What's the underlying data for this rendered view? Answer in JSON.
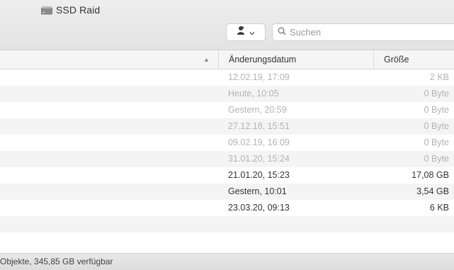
{
  "window": {
    "volume_name": "SSD Raid"
  },
  "toolbar": {
    "search_placeholder": "Suchen"
  },
  "columns": {
    "date": "Änderungsdatum",
    "size": "Größe"
  },
  "rows": [
    {
      "date": "12.02.19, 17:09",
      "size": "2 KB",
      "dim": true
    },
    {
      "date": "Heute, 10:05",
      "size": "0 Byte",
      "dim": true
    },
    {
      "date": "Gestern, 20:59",
      "size": "0 Byte",
      "dim": true
    },
    {
      "date": "27.12.18, 15:51",
      "size": "0 Byte",
      "dim": true
    },
    {
      "date": "09.02.19, 16:09",
      "size": "0 Byte",
      "dim": true
    },
    {
      "date": "31.01.20, 15:24",
      "size": "0 Byte",
      "dim": true
    },
    {
      "date": "21.01.20, 15:23",
      "size": "17,08 GB",
      "dim": false
    },
    {
      "date": "Gestern, 10:01",
      "size": "3,54 GB",
      "dim": false
    },
    {
      "date": "23.03.20, 09:13",
      "size": "6 KB",
      "dim": false
    }
  ],
  "status_bar": {
    "text": "Objekte, 345,85 GB verfügbar"
  },
  "colors": {
    "dim_text": "#b3b3b3",
    "normal_text": "#333333",
    "stripe": "#f4f4f4"
  }
}
